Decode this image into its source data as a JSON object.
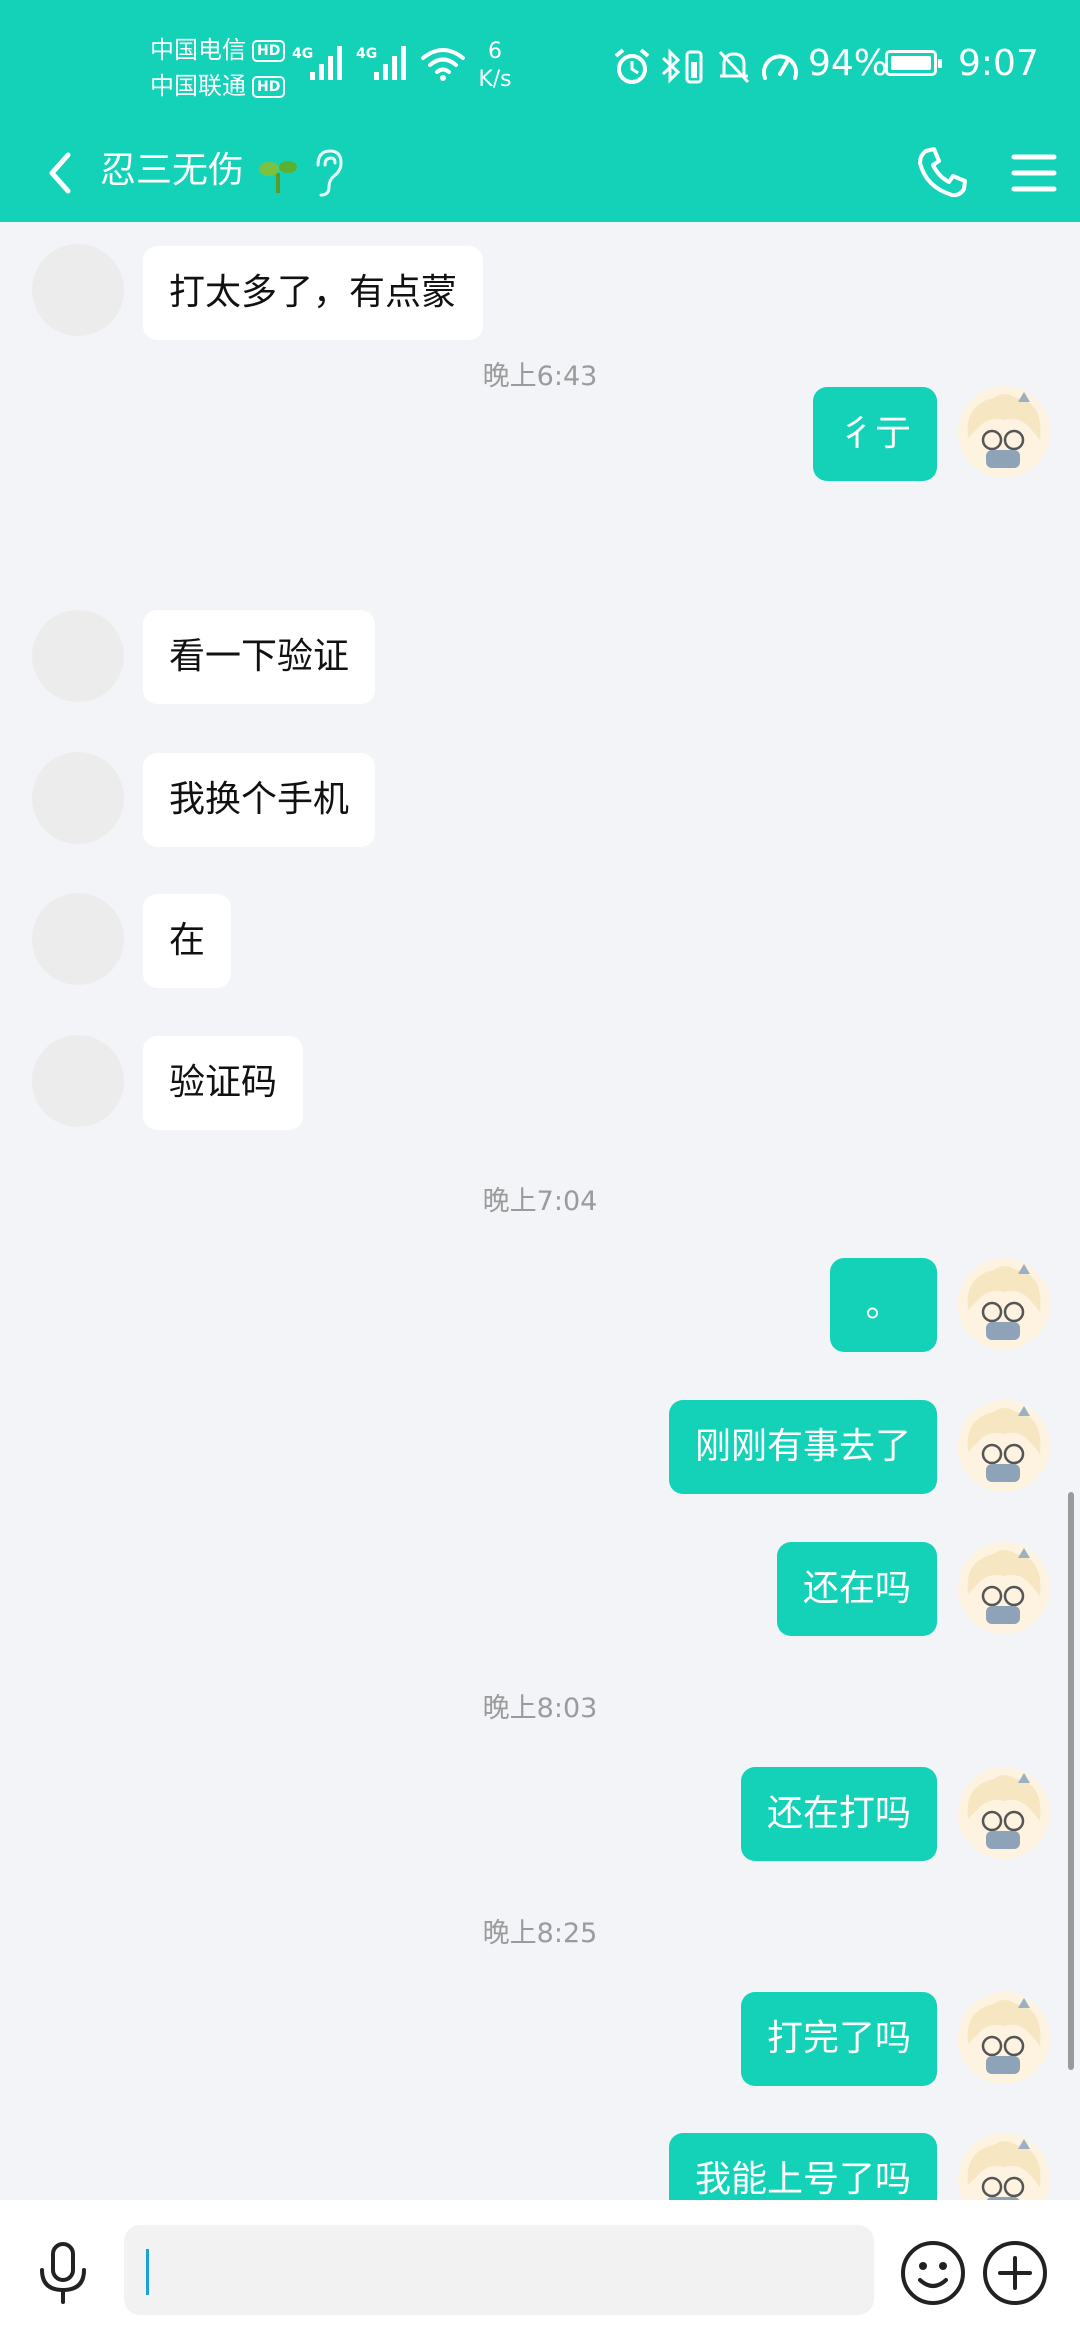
{
  "status_bar": {
    "carrier_1": "中国电信",
    "carrier_2": "中国联通",
    "hd_badge": "HD",
    "network_1": "4G",
    "network_2": "4G",
    "speed_value": "6",
    "speed_unit": "K/s",
    "battery_percent": "94%",
    "time": "9:07"
  },
  "header": {
    "title": "忍三无伤"
  },
  "messages": [
    {
      "type": "in",
      "text": "打太多了，有点蒙"
    },
    {
      "type": "out",
      "text": "彳亍"
    },
    {
      "type": "time",
      "text": "晚上6:43"
    },
    {
      "type": "in",
      "text": "看一下验证"
    },
    {
      "type": "in",
      "text": "我换个手机"
    },
    {
      "type": "in",
      "text": "在"
    },
    {
      "type": "in",
      "text": "验证码"
    },
    {
      "type": "time",
      "text": "晚上7:04"
    },
    {
      "type": "out",
      "text": "。"
    },
    {
      "type": "out",
      "text": "刚刚有事去了"
    },
    {
      "type": "out",
      "text": "还在吗"
    },
    {
      "type": "time",
      "text": "晚上8:03"
    },
    {
      "type": "out",
      "text": "还在打吗"
    },
    {
      "type": "time",
      "text": "晚上8:25"
    },
    {
      "type": "out",
      "text": "打完了吗"
    },
    {
      "type": "out",
      "text": "我能上号了吗"
    }
  ],
  "input": {
    "value": ""
  },
  "colors": {
    "accent": "#13d2b8",
    "background": "#f3f4f8",
    "incoming_bubble": "#ffffff",
    "timestamp": "#9b9b9b"
  },
  "icons": [
    "back-arrow-icon",
    "sprout-icon",
    "ear-icon",
    "phone-icon",
    "menu-icon",
    "mic-icon",
    "emoji-icon",
    "plus-icon",
    "alarm-icon",
    "bluetooth-icon",
    "mute-bell-icon",
    "speedometer-icon",
    "wifi-icon",
    "signal-icon"
  ]
}
